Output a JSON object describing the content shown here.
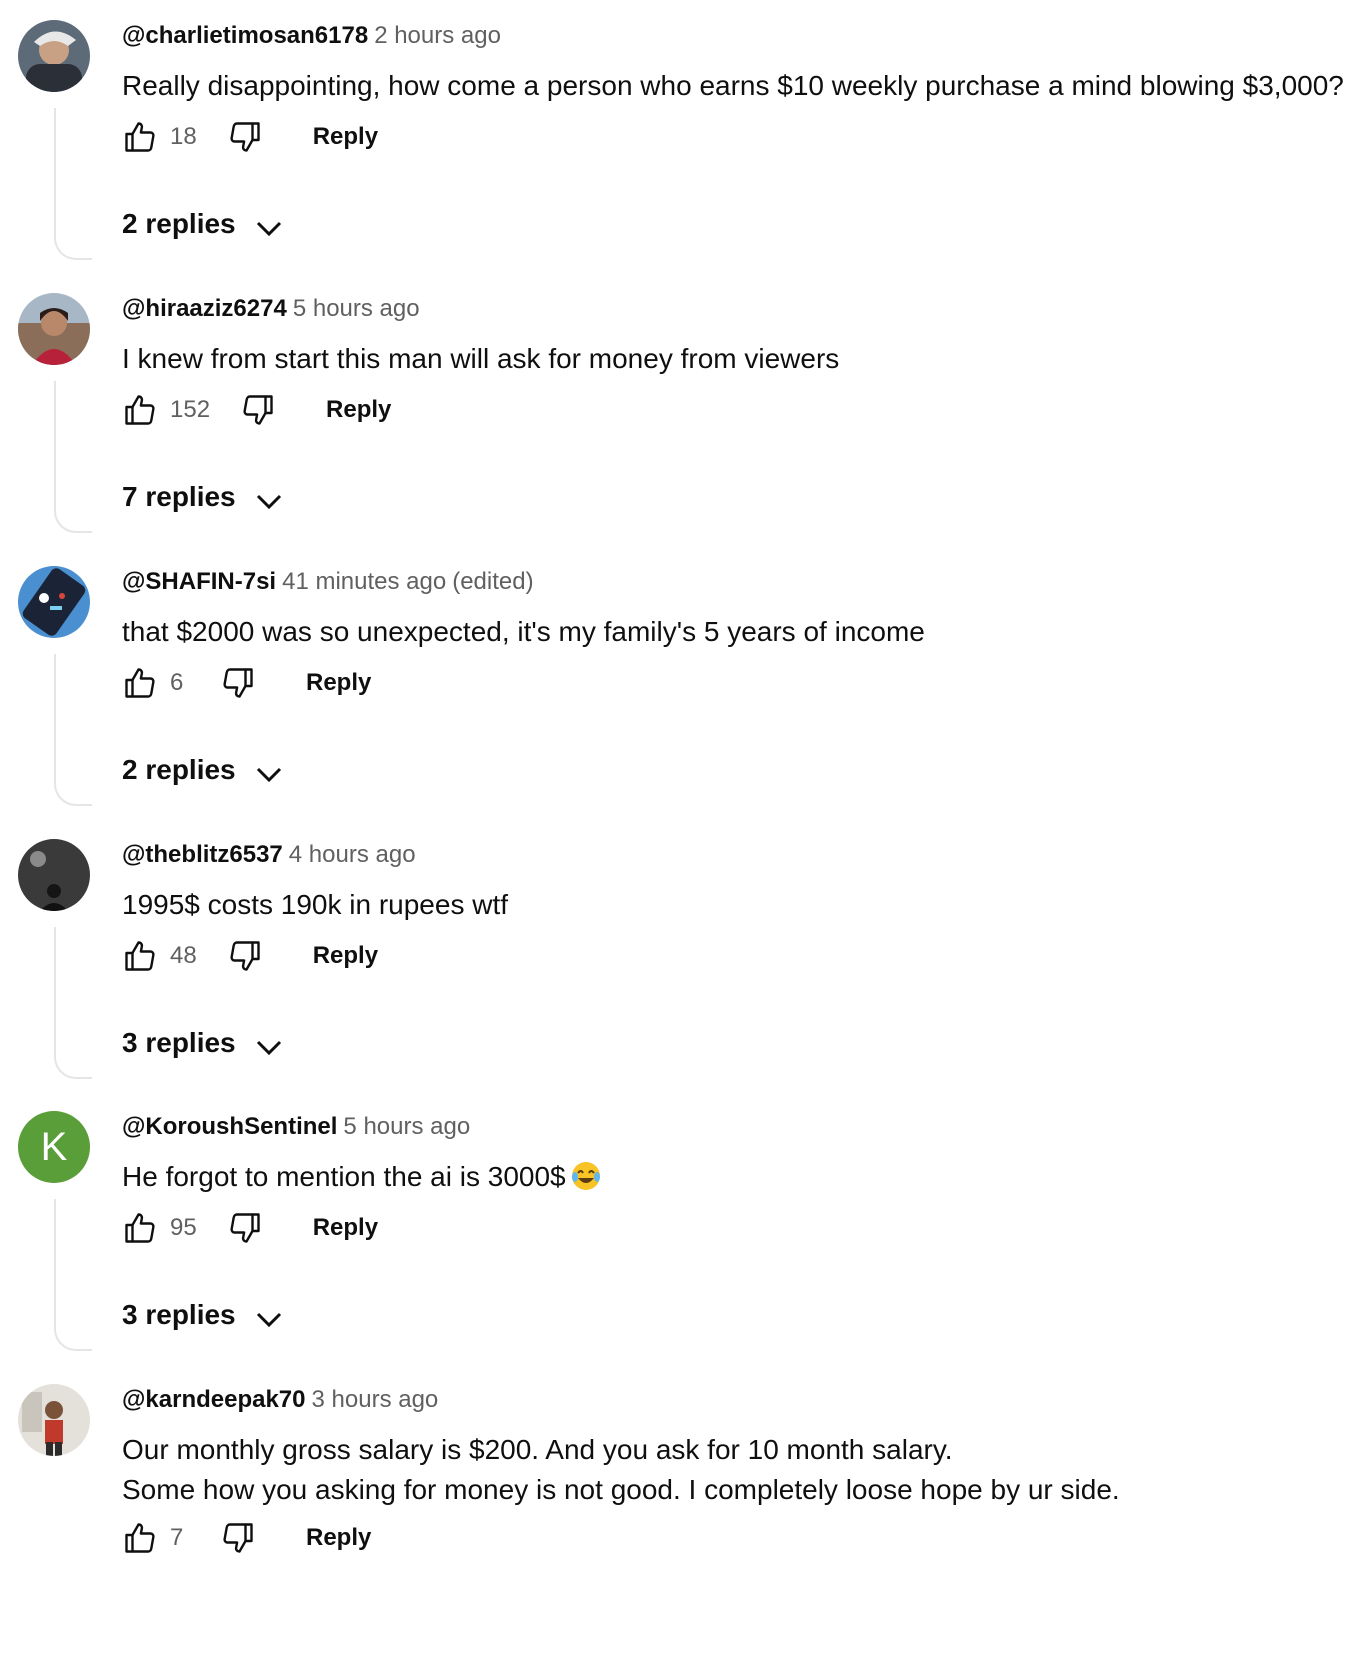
{
  "comments": [
    {
      "author": "@charlietimosan6178",
      "time": "2 hours ago",
      "edited": "",
      "text": [
        "Really disappointing, how come a person who earns $10 weekly purchase a mind blowing $3,000?"
      ],
      "likes": "18",
      "reply_label": "Reply",
      "replies_label": "2 replies"
    },
    {
      "author": "@hiraaziz6274",
      "time": "5 hours ago",
      "edited": "",
      "text": [
        "I knew from start this man will ask for money from viewers"
      ],
      "likes": "152",
      "reply_label": "Reply",
      "replies_label": "7 replies"
    },
    {
      "author": "@SHAFIN-7si",
      "time": "41 minutes ago",
      "edited": "(edited)",
      "text": [
        "that $2000 was so unexpected, it's my family's 5 years of income"
      ],
      "likes": "6",
      "reply_label": "Reply",
      "replies_label": "2 replies"
    },
    {
      "author": "@theblitz6537",
      "time": "4 hours ago",
      "edited": "",
      "text": [
        "1995$ costs 190k in rupees wtf"
      ],
      "likes": "48",
      "reply_label": "Reply",
      "replies_label": "3 replies"
    },
    {
      "author": "@KoroushSentinel",
      "time": "5 hours ago",
      "edited": "",
      "text": [
        "He forgot to mention the ai is 3000$"
      ],
      "emoji": "face-with-tears-of-joy",
      "avatar_letter": "K",
      "likes": "95",
      "reply_label": "Reply",
      "replies_label": "3 replies"
    },
    {
      "author": "@karndeepak70",
      "time": "3 hours ago",
      "edited": "",
      "text": [
        "Our monthly gross salary is $200. And you ask for 10 month salary.",
        "Some how you asking for money is not good. I completely loose hope by ur side."
      ],
      "likes": "7",
      "reply_label": "Reply",
      "replies_label": ""
    }
  ],
  "icons": {
    "like": "thumbs-up-icon",
    "dislike": "thumbs-down-icon",
    "expand": "chevron-down-icon"
  },
  "colors": {
    "text": "#0f0f0f",
    "secondary": "#606060",
    "thread_line": "#e5e5e5",
    "letter_avatar_bg": "#5a9e3a"
  }
}
